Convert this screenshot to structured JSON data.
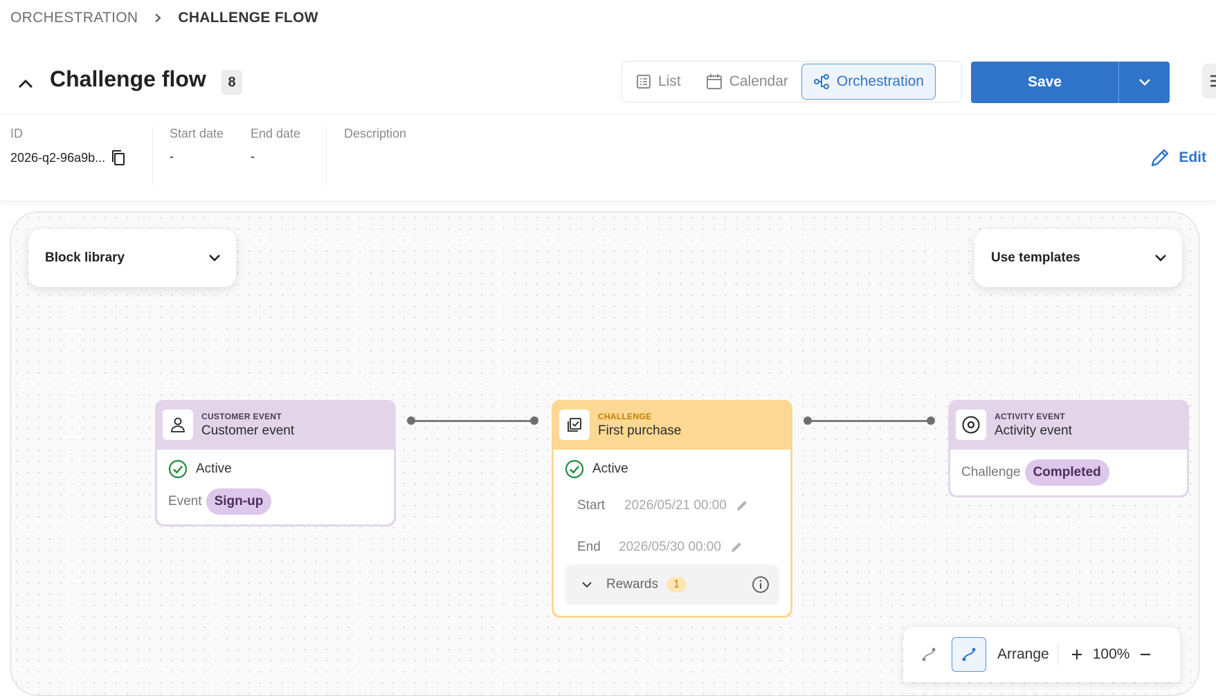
{
  "breadcrumb": {
    "parent": "ORCHESTRATION",
    "current": "CHALLENGE FLOW"
  },
  "header": {
    "title": "Challenge flow",
    "count": "8",
    "views": [
      {
        "label": "List",
        "icon": "list-icon"
      },
      {
        "label": "Calendar",
        "icon": "calendar-icon"
      },
      {
        "label": "Orchestration",
        "icon": "flow-icon",
        "active": true
      }
    ],
    "save_label": "Save"
  },
  "info": {
    "id_label": "ID",
    "id_value": "2026-q2-96a9b...",
    "start_label": "Start date",
    "start_value": "-",
    "end_label": "End date",
    "end_value": "-",
    "description_label": "Description",
    "edit_label": "Edit"
  },
  "canvas": {
    "block_library": "Block library",
    "use_templates": "Use templates",
    "nodes": {
      "customer": {
        "kind": "CUSTOMER EVENT",
        "name": "Customer event",
        "status": "Active",
        "event_label": "Event",
        "event_value": "Sign-up"
      },
      "challenge": {
        "kind": "CHALLENGE",
        "name": "First purchase",
        "status": "Active",
        "start_label": "Start",
        "start_value": "2026/05/21 00:00",
        "end_label": "End",
        "end_value": "2026/05/30 00:00",
        "rewards_label": "Rewards",
        "rewards_count": "1"
      },
      "activity": {
        "kind": "ACTIVITY EVENT",
        "name": "Activity event",
        "challenge_label": "Challenge",
        "challenge_value": "Completed"
      }
    },
    "zoom": {
      "arrange_label": "Arrange",
      "zoom_level": "100%"
    }
  },
  "colors": {
    "accent": "#2f74c9",
    "purple_node": "#e2d5ea",
    "yellow_node": "#fbd893",
    "active_green": "#1e8a3a"
  }
}
